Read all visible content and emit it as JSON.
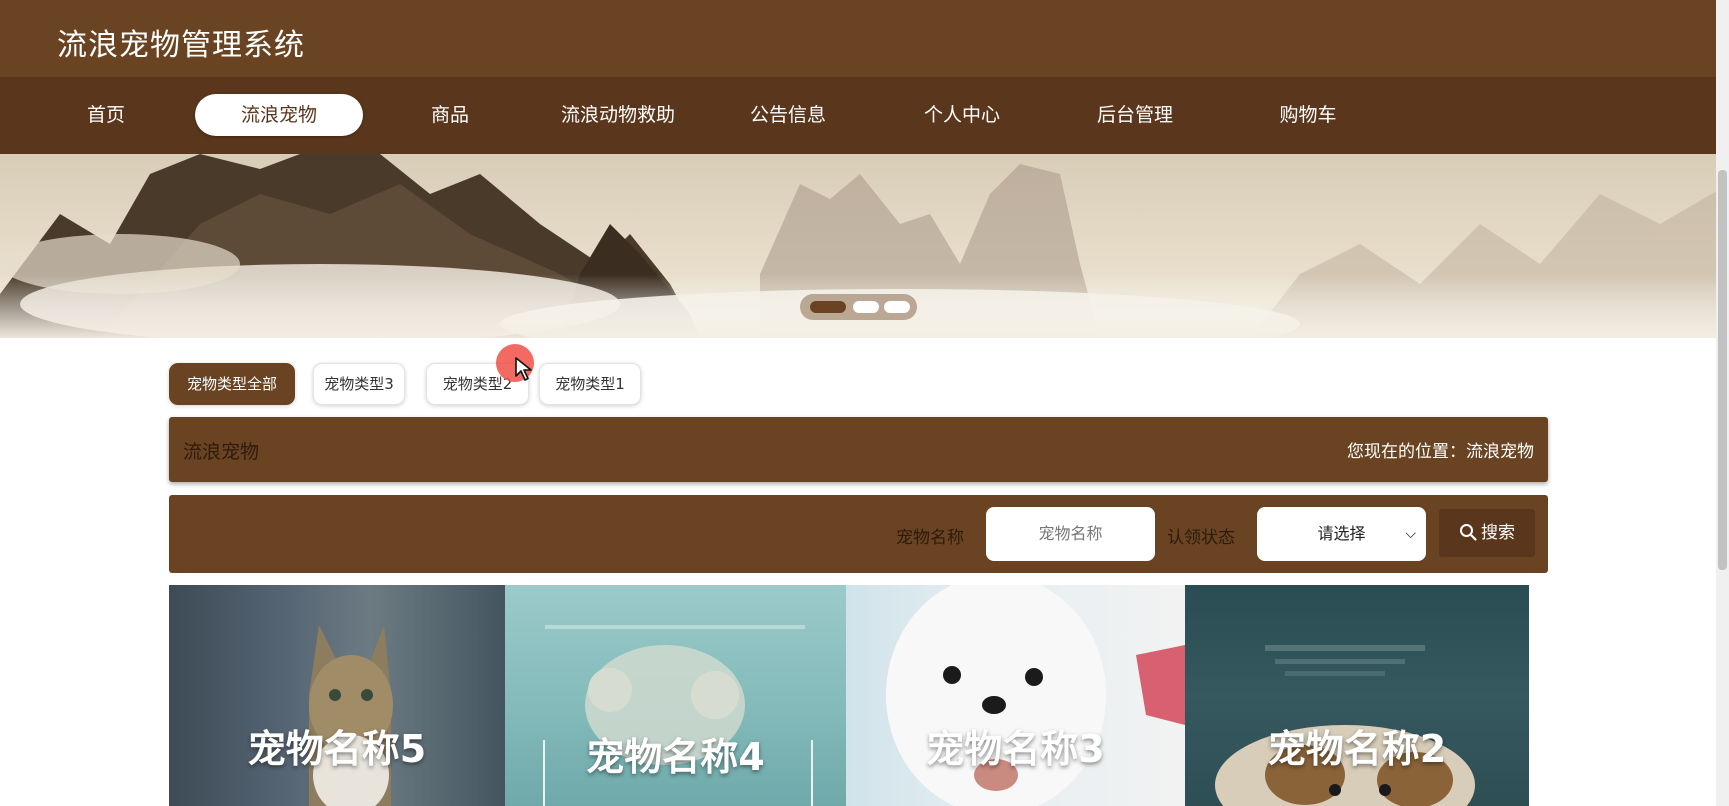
{
  "header": {
    "title": "流浪宠物管理系统"
  },
  "nav": {
    "items": [
      {
        "label": "首页",
        "active": false
      },
      {
        "label": "流浪宠物",
        "active": true
      },
      {
        "label": "商品",
        "active": false
      },
      {
        "label": "流浪动物救助",
        "active": false
      },
      {
        "label": "公告信息",
        "active": false
      },
      {
        "label": "个人中心",
        "active": false
      },
      {
        "label": "后台管理",
        "active": false
      },
      {
        "label": "购物车",
        "active": false
      }
    ]
  },
  "carousel": {
    "active_index": 0,
    "count": 3
  },
  "categories": [
    {
      "label": "宠物类型全部",
      "active": true
    },
    {
      "label": "宠物类型3",
      "active": false
    },
    {
      "label": "宠物类型2",
      "active": false
    },
    {
      "label": "宠物类型1",
      "active": false
    }
  ],
  "section": {
    "title": "流浪宠物",
    "location": "您现在的位置：流浪宠物"
  },
  "search": {
    "name_label": "宠物名称",
    "name_placeholder": "宠物名称",
    "status_label": "认领状态",
    "status_selected": "请选择",
    "button_label": "搜索"
  },
  "pets": [
    {
      "name": "宠物名称5"
    },
    {
      "name": "宠物名称4"
    },
    {
      "name": "宠物名称3"
    },
    {
      "name": "宠物名称2"
    }
  ],
  "colors": {
    "brand_brown": "#6a4422",
    "nav_brown": "#5a371c"
  },
  "icons": {
    "search": "search-icon",
    "select_arrow": "chevron-down-icon"
  }
}
